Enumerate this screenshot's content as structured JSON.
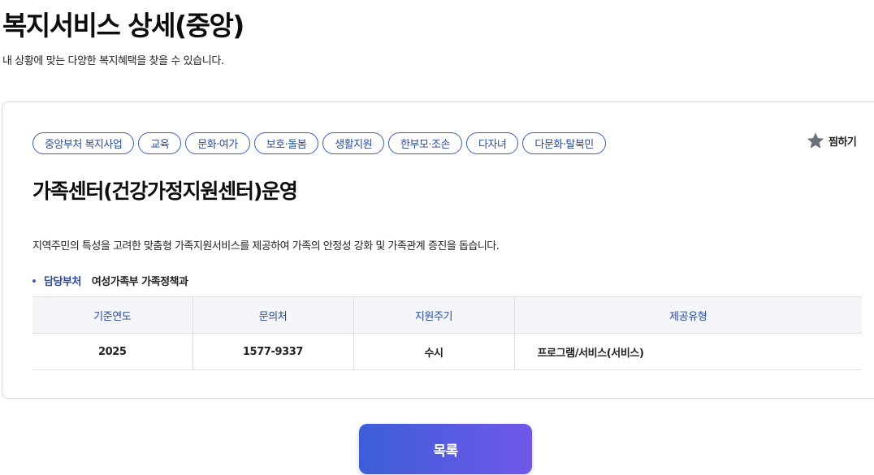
{
  "header": {
    "title": "복지서비스 상세(중앙)",
    "subtitle": "내 상황에 맞는 다양한 복지혜택을 찾을 수 있습니다."
  },
  "service": {
    "tags": [
      "중앙부처 복지사업",
      "교육",
      "문화·여가",
      "보호·돌봄",
      "생활지원",
      "한부모·조손",
      "다자녀",
      "다문화·탈북민"
    ],
    "bookmark_label": "찜하기",
    "bookmark_icon": "star-icon",
    "title": "가족센터(건강가정지원센터)운영",
    "description": "지역주민의 특성을 고려한 맞춤형 가족지원서비스를 제공하여 가족의 안정성 강화 및 가족관계 증진을 돕습니다.",
    "department_label": "담당부처",
    "department_value": "여성가족부 가족정책과"
  },
  "info_table": {
    "headers": [
      "기준연도",
      "문의처",
      "지원주기",
      "제공유형"
    ],
    "row": [
      "2025",
      "1577-9337",
      "수시",
      "프로그램/서비스(서비스)"
    ]
  },
  "footer": {
    "list_button_label": "목록"
  },
  "colors": {
    "accent": "#2a4aa0",
    "button_gradient_start": "#3d5ed8",
    "button_gradient_end": "#6f58e8"
  }
}
